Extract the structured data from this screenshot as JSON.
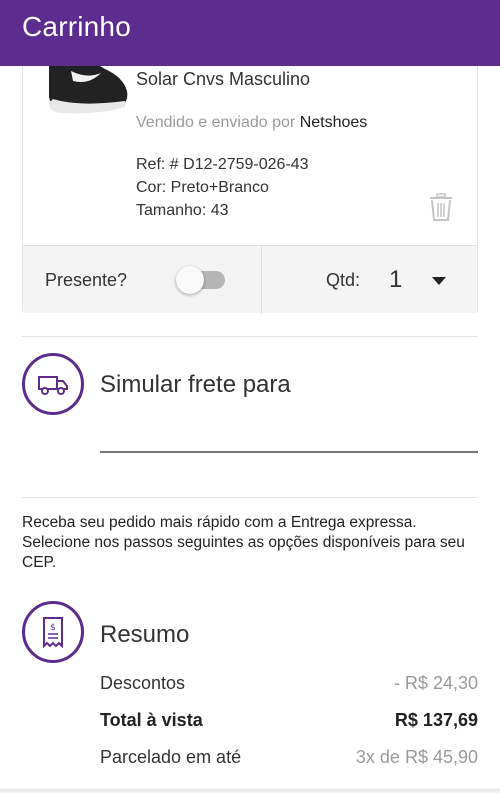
{
  "appbar": {
    "title": "Carrinho"
  },
  "product": {
    "name": "Solar Cnvs Masculino",
    "seller_prefix": "Vendido e enviado por",
    "seller_name": "Netshoes",
    "ref": "Ref: # D12-2759-026-43",
    "color": "Cor: Preto+Branco",
    "size": "Tamanho: 43",
    "gift_label": "Presente?",
    "gift_on": false,
    "qty_label": "Qtd:",
    "qty_value": "1"
  },
  "shipping": {
    "title": "Simular frete para",
    "cep_value": "",
    "info": "Receba seu pedido mais rápido com a Entrega expressa. Selecione nos passos seguintes as opções disponíveis para seu CEP."
  },
  "summary": {
    "title": "Resumo",
    "discount_label": "Descontos",
    "discount_value": "- R$ 24,30",
    "total_label": "Total à vista",
    "total_value": "R$ 137,69",
    "installments_label": "Parcelado em até",
    "installments_value": "3x de R$ 45,90"
  },
  "colors": {
    "brand": "#5c2d8f"
  }
}
